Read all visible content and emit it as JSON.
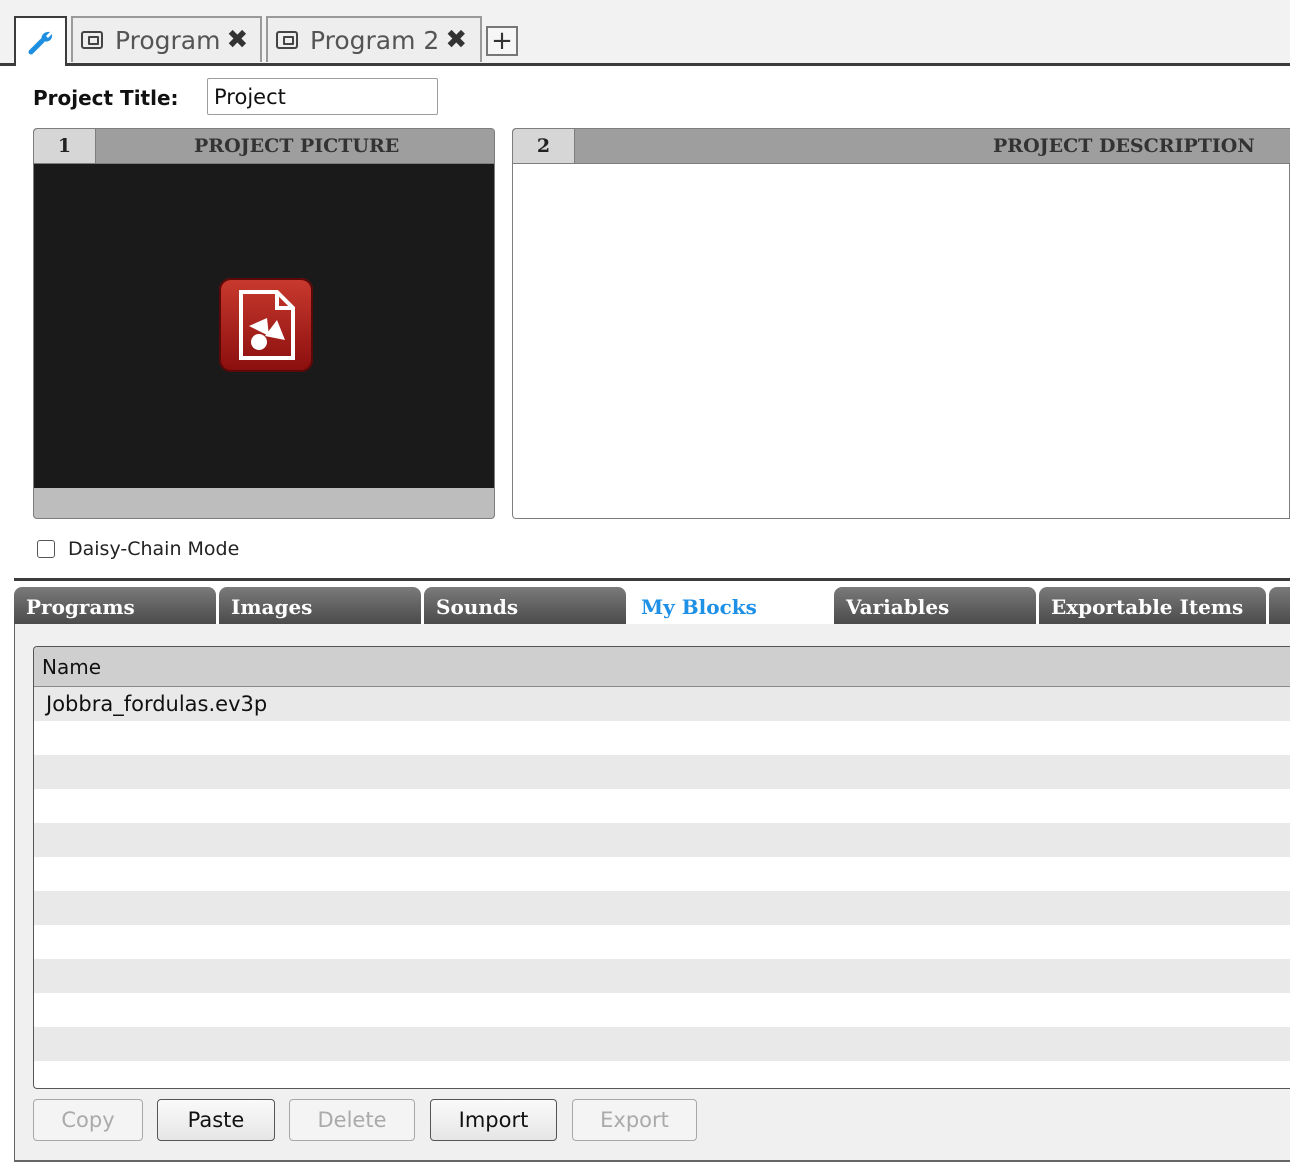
{
  "top_tabs": [
    {
      "kind": "project-properties",
      "icon": "wrench-icon",
      "active": true
    },
    {
      "label": "Program",
      "icon": "program-icon",
      "closable": true
    },
    {
      "label": "Program 2",
      "icon": "program-icon",
      "closable": true
    }
  ],
  "add_tab_label": "+",
  "close_glyph": "✖",
  "project": {
    "title_label": "Project Title:",
    "title_value": "Project"
  },
  "picture_panel": {
    "number": "1",
    "title": "PROJECT PICTURE",
    "icon": "image-file-icon"
  },
  "description_panel": {
    "number": "2",
    "title": "PROJECT DESCRIPTION"
  },
  "daisy_chain": {
    "label": "Daisy-Chain Mode",
    "checked": false
  },
  "lower_tabs": [
    {
      "label": "Programs"
    },
    {
      "label": "Images"
    },
    {
      "label": "Sounds"
    },
    {
      "label": "My Blocks",
      "active": true
    },
    {
      "label": "Variables"
    },
    {
      "label": "Exportable Items"
    }
  ],
  "list": {
    "column_header": "Name",
    "rows": [
      "Jobbra_fordulas.ev3p"
    ]
  },
  "buttons": {
    "copy": "Copy",
    "paste": "Paste",
    "delete": "Delete",
    "import": "Import",
    "export": "Export"
  },
  "colors": {
    "active_tab_text": "#1e90e6",
    "picture_bg": "#1a1a1a",
    "picture_icon": "#b0201c"
  }
}
